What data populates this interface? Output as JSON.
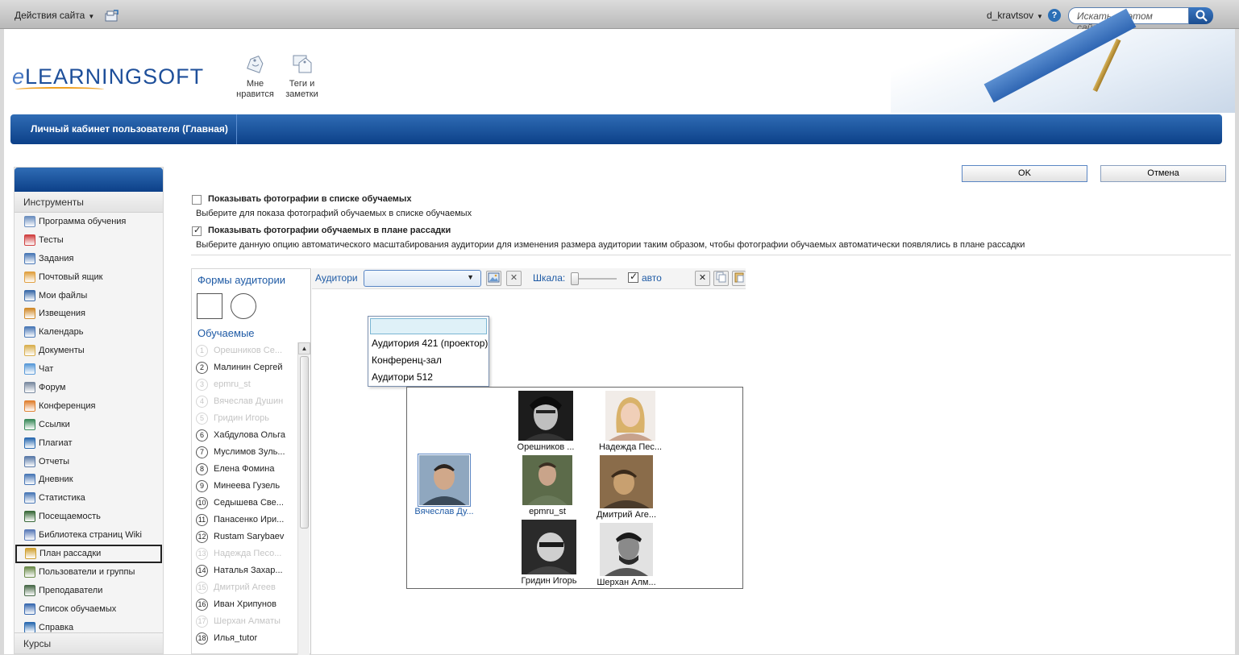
{
  "topbar": {
    "site_actions": "Действия сайта",
    "username": "d_kravtsov",
    "search_placeholder": "Искать на этом сайте..."
  },
  "header": {
    "logo": "eLEARNINGSOFT",
    "logo_e": "e",
    "logo_rest": "LEARNINGSOFT",
    "like_label": "Мне нравится",
    "tags_label": "Теги и заметки"
  },
  "navbar": {
    "tab": "Личный кабинет пользователя (Главная)"
  },
  "leftnav": {
    "section_tools": "Инструменты",
    "section_courses": "Курсы",
    "items": [
      {
        "label": "Программа обучения",
        "icon": "program-icon",
        "color": "#6c8fbf"
      },
      {
        "label": "Тесты",
        "icon": "tests-icon",
        "color": "#d04040"
      },
      {
        "label": "Задания",
        "icon": "tasks-icon",
        "color": "#4a78b6"
      },
      {
        "label": "Почтовый ящик",
        "icon": "mailbox-icon",
        "color": "#e0a040"
      },
      {
        "label": "Мои файлы",
        "icon": "files-icon",
        "color": "#3a6aa8"
      },
      {
        "label": "Извещения",
        "icon": "notices-icon",
        "color": "#d08a2a"
      },
      {
        "label": "Календарь",
        "icon": "calendar-icon",
        "color": "#4a78b6"
      },
      {
        "label": "Документы",
        "icon": "documents-icon",
        "color": "#d9b050"
      },
      {
        "label": "Чат",
        "icon": "chat-icon",
        "color": "#5a9ad8"
      },
      {
        "label": "Форум",
        "icon": "forum-icon",
        "color": "#7a8aa0"
      },
      {
        "label": "Конференция",
        "icon": "conference-icon",
        "color": "#e08030"
      },
      {
        "label": "Ссылки",
        "icon": "links-icon",
        "color": "#3a8a5a"
      },
      {
        "label": "Плагиат",
        "icon": "plagiarism-icon",
        "color": "#2a6ab0"
      },
      {
        "label": "Отчеты",
        "icon": "reports-icon",
        "color": "#5a7aa8"
      },
      {
        "label": "Дневник",
        "icon": "diary-icon",
        "color": "#4a78b6"
      },
      {
        "label": "Статистика",
        "icon": "statistics-icon",
        "color": "#4a78b6"
      },
      {
        "label": "Посещаемость",
        "icon": "attendance-icon",
        "color": "#3a6a3a"
      },
      {
        "label": "Библиотека страниц Wiki",
        "icon": "wiki-icon",
        "color": "#5a7ab8"
      },
      {
        "label": "План рассадки",
        "icon": "seating-icon",
        "color": "#d0a030",
        "selected": true
      },
      {
        "label": "Пользователи и группы",
        "icon": "users-icon",
        "color": "#6a8a4a"
      },
      {
        "label": "Преподаватели",
        "icon": "teachers-icon",
        "color": "#4a6a4a"
      },
      {
        "label": "Список обучаемых",
        "icon": "learners-list-icon",
        "color": "#3a6ab0"
      },
      {
        "label": "Справка",
        "icon": "help-icon",
        "color": "#2a6ab0"
      }
    ]
  },
  "buttons": {
    "ok": "OK",
    "cancel": "Отмена"
  },
  "options": {
    "show_photos_list": {
      "label": "Показывать фотографии в списке обучаемых",
      "desc": "Выберите для показа фотографий обучаемых в списке обучаемых",
      "checked": false
    },
    "show_photos_plan": {
      "label": "Показывать фотографии обучаемых в плане рассадки",
      "desc": "Выберите данную опцию автоматического масштабирования аудитории для изменения размера аудитории таким образом, чтобы фотографии обучаемых автоматически появлялись в плане рассадки",
      "checked": true
    }
  },
  "editor": {
    "shapes_title": "Формы аудитории",
    "learners_title": "Обучаемые",
    "learners": [
      {
        "n": "1",
        "name": "Орешников Се...",
        "dim": true
      },
      {
        "n": "2",
        "name": "Малинин Сергей",
        "dim": false
      },
      {
        "n": "3",
        "name": "epmru_st",
        "dim": true
      },
      {
        "n": "4",
        "name": "Вячеслав Душин",
        "dim": true
      },
      {
        "n": "5",
        "name": "Гридин Игорь",
        "dim": true
      },
      {
        "n": "6",
        "name": "Хабдулова Ольга",
        "dim": false
      },
      {
        "n": "7",
        "name": "Муслимов Зуль...",
        "dim": false
      },
      {
        "n": "8",
        "name": "Елена Фомина",
        "dim": false
      },
      {
        "n": "9",
        "name": "Минеева Гузель",
        "dim": false
      },
      {
        "n": "10",
        "name": "Седышева Све...",
        "dim": false
      },
      {
        "n": "11",
        "name": "Панасенко Ири...",
        "dim": false
      },
      {
        "n": "12",
        "name": "Rustam Sarybaev",
        "dim": false
      },
      {
        "n": "13",
        "name": "Надежда Песо...",
        "dim": true
      },
      {
        "n": "14",
        "name": "Наталья  Захар...",
        "dim": false
      },
      {
        "n": "15",
        "name": "Дмитрий Агеев",
        "dim": true
      },
      {
        "n": "16",
        "name": "Иван Хрипунов",
        "dim": false
      },
      {
        "n": "17",
        "name": "Шерхан Алматы",
        "dim": true
      },
      {
        "n": "18",
        "name": "Илья_tutor",
        "dim": false
      }
    ],
    "toolbar": {
      "auditorium_label": "Аудитори",
      "scale_label": "Шкала:",
      "auto_label": "авто",
      "auto_checked": true
    },
    "dropdown_options": [
      "Аудитория 421 (проектор)",
      "Конференц-зал",
      "Аудитори 512"
    ],
    "seats": [
      {
        "name": "Орешников ...",
        "selected": false
      },
      {
        "name": "Надежда Пес...",
        "selected": false
      },
      {
        "name": "Вячеслав Ду...",
        "selected": true
      },
      {
        "name": "epmru_st",
        "selected": false
      },
      {
        "name": "Дмитрий Аге...",
        "selected": false
      },
      {
        "name": "Гридин Игорь",
        "selected": false
      },
      {
        "name": "Шерхан Алм...",
        "selected": false
      }
    ]
  },
  "colors": {
    "brand_blue": "#0c4088",
    "accent_blue": "#1e5aa5"
  }
}
